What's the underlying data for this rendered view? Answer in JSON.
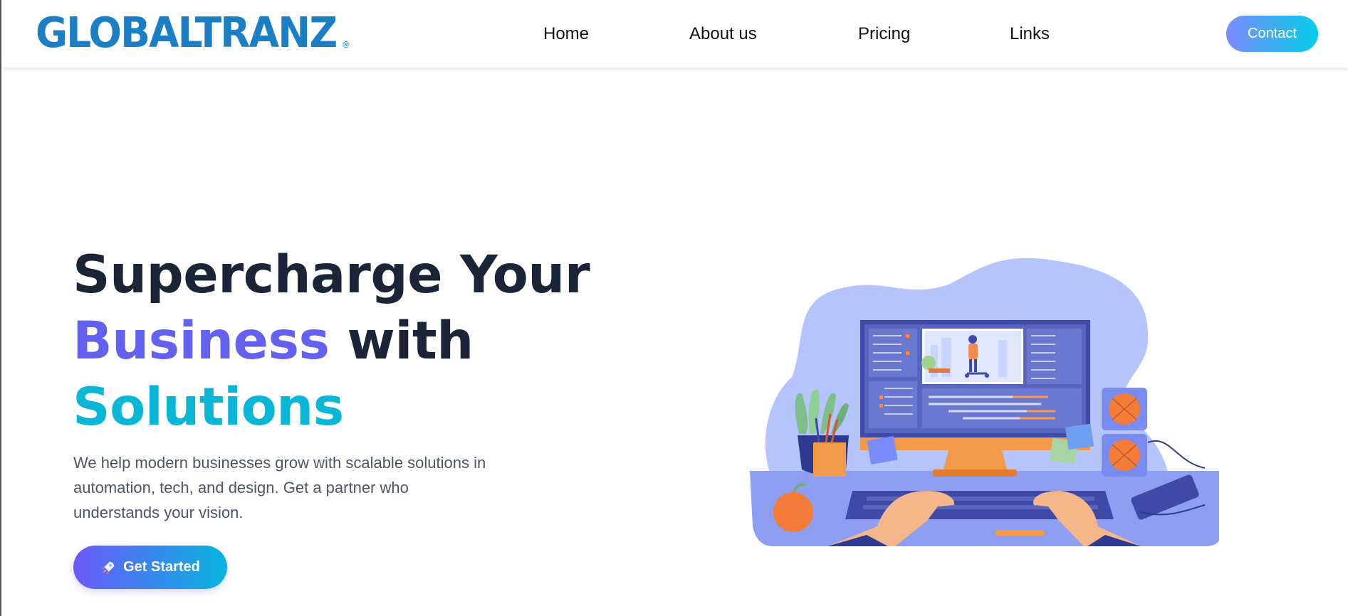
{
  "brand": {
    "logo_text": "GLOBALTRANZ",
    "logo_mark": "®",
    "color": "#1a7fc4"
  },
  "nav": {
    "items": [
      {
        "label": "Home"
      },
      {
        "label": "About us"
      },
      {
        "label": "Pricing"
      },
      {
        "label": "Links"
      }
    ],
    "contact_label": "Contact"
  },
  "hero": {
    "title_line1": "Supercharge Your",
    "title_word_business": "Business",
    "title_word_with": " with",
    "title_word_solutions": "Solutions",
    "description": "We help modern businesses grow with scalable solutions in automation, tech, and design. Get a partner who understands your vision.",
    "cta_label": "Get Started",
    "cta_icon": "rocket-icon"
  },
  "colors": {
    "heading": "#1c2537",
    "accent_purple": "#6460f0",
    "accent_cyan": "#08b7d6",
    "text": "#4b5566"
  },
  "illustration": {
    "icon": "workspace-illustration"
  }
}
